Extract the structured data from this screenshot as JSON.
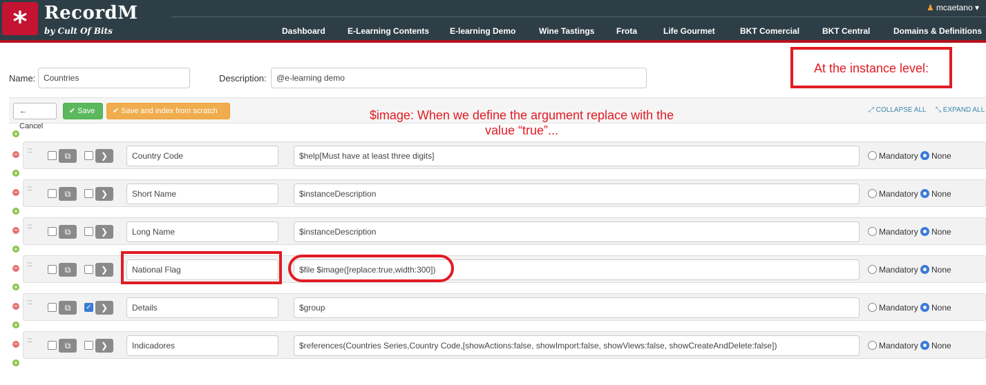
{
  "header": {
    "brand": "RecordM",
    "brand_sub": "by Cult Of Bits",
    "user": "mcaetano",
    "nav": [
      "Dashboard",
      "E-Learning Contents",
      "E-learning Demo",
      "Wine Tastings",
      "Frota",
      "Life Gourmet",
      "BKT Comercial",
      "BKT Central",
      "Domains & Definitions"
    ]
  },
  "form": {
    "name_label": "Name:",
    "name_value": "Countries",
    "description_label": "Description:",
    "description_value": "@e-learning demo"
  },
  "toolbar": {
    "cancel": "Cancel",
    "save": "Save",
    "save_index": "Save and index from scratch",
    "collapse_all": "COLLAPSE ALL",
    "expand_all": "EXPAND ALL"
  },
  "annotations": {
    "instance_level": "At the instance level:",
    "image_note_line1": "$image: When we define the argument replace with the",
    "image_note_line2": "value “true”..."
  },
  "radio_labels": {
    "mandatory": "Mandatory",
    "none": "None"
  },
  "fields": [
    {
      "name": "Country Code",
      "description": "$help[Must have at least three digits]",
      "checked": false
    },
    {
      "name": "Short Name",
      "description": "$instanceDescription",
      "checked": false
    },
    {
      "name": "Long Name",
      "description": "$instanceDescription",
      "checked": false
    },
    {
      "name": "National Flag",
      "description": "$file $image([replace:true,width:300])",
      "checked": false
    },
    {
      "name": "Details",
      "description": "$group",
      "checked": true
    },
    {
      "name": "Indicadores",
      "description": "$references(Countries Series,Country Code,[showActions:false, showImport:false, showViews:false, showCreateAndDelete:false])",
      "checked": false
    }
  ]
}
